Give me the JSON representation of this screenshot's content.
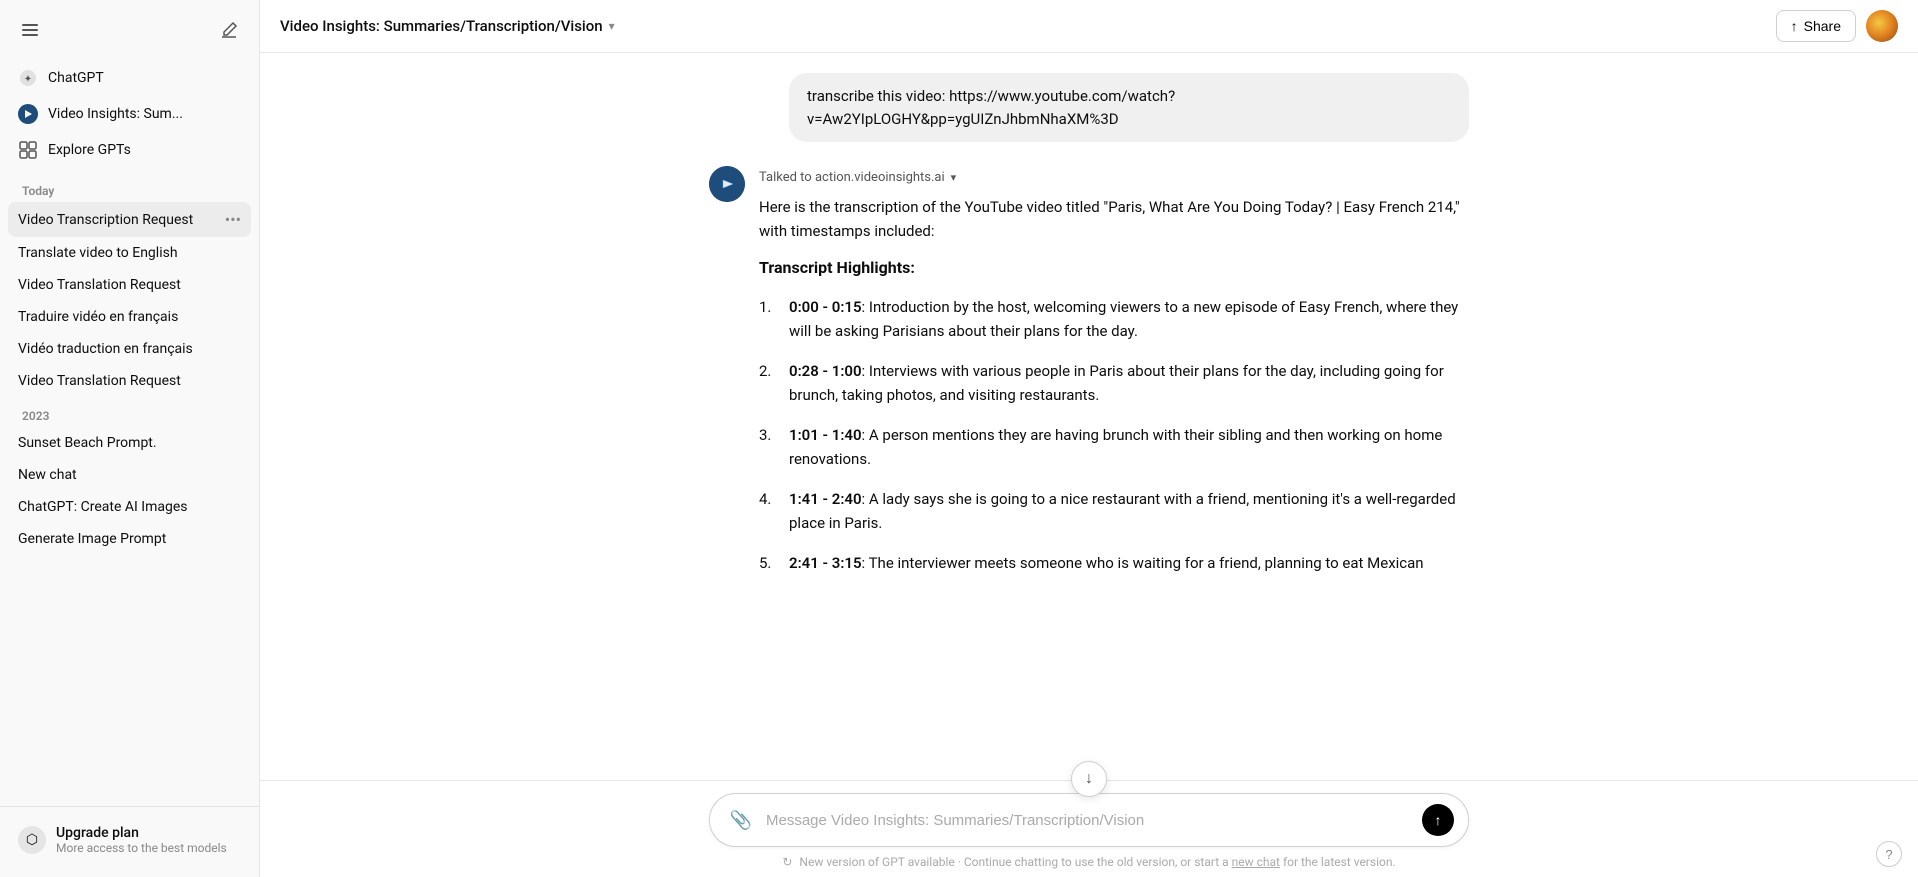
{
  "sidebar": {
    "toggle_label": "Toggle sidebar",
    "new_chat_label": "New chat",
    "nav_items": [
      {
        "id": "chatgpt",
        "label": "ChatGPT",
        "icon": "✦"
      },
      {
        "id": "video-insights",
        "label": "Video Insights: Sum...",
        "icon": "▶"
      },
      {
        "id": "explore",
        "label": "Explore GPTs",
        "icon": "⊞"
      }
    ],
    "sections": [
      {
        "label": "Today",
        "items": [
          {
            "id": "video-transcription",
            "label": "Video Transcription Request",
            "active": true
          },
          {
            "id": "translate-video",
            "label": "Translate video to English"
          },
          {
            "id": "video-translation",
            "label": "Video Translation Request"
          },
          {
            "id": "traduire-video",
            "label": "Traduire vidéo en français"
          },
          {
            "id": "video-traduction",
            "label": "Vidéo traduction en français"
          },
          {
            "id": "video-translation-2",
            "label": "Video Translation Request"
          }
        ]
      },
      {
        "label": "2023",
        "items": [
          {
            "id": "sunset-beach",
            "label": "Sunset Beach Prompt."
          },
          {
            "id": "new-chat",
            "label": "New chat"
          },
          {
            "id": "chatgpt-ai-images",
            "label": "ChatGPT: Create AI Images"
          },
          {
            "id": "generate-image",
            "label": "Generate Image Prompt"
          }
        ]
      }
    ],
    "upgrade": {
      "title": "Upgrade plan",
      "subtitle": "More access to the best models",
      "icon": "⬡"
    }
  },
  "topbar": {
    "title": "Video Insights: Summaries/Transcription/Vision",
    "share_label": "Share",
    "share_icon": "↑"
  },
  "messages": [
    {
      "type": "user",
      "text": "transcribe this video: https://www.youtube.com/watch?v=Aw2YIpLOGHY&pp=ygUIZnJhbmNhaXM%3D"
    },
    {
      "type": "ai",
      "source": "Talked to action.videoinsights.ai",
      "intro": "Here is the transcription of the YouTube video titled \"Paris, What Are You Doing Today? | Easy French 214,\" with timestamps included:",
      "section_heading": "Transcript Highlights:",
      "items": [
        {
          "num": "1.",
          "timestamp": "0:00 - 0:15",
          "text": ": Introduction by the host, welcoming viewers to a new episode of Easy French, where they will be asking Parisians about their plans for the day."
        },
        {
          "num": "2.",
          "timestamp": "0:28 - 1:00",
          "text": ": Interviews with various people in Paris about their plans for the day, including going for brunch, taking photos, and visiting restaurants."
        },
        {
          "num": "3.",
          "timestamp": "1:01 - 1:40",
          "text": ": A person mentions they are having brunch with their sibling and then working on home renovations."
        },
        {
          "num": "4.",
          "timestamp": "1:41 - 2:40",
          "text": ": A lady says she is going to a nice restaurant with a friend, mentioning it's a well-regarded place in Paris."
        },
        {
          "num": "5.",
          "timestamp": "2:41 - 3:15",
          "text": ": The interviewer meets someone who is waiting for a friend, planning to eat Mexican"
        }
      ]
    }
  ],
  "input": {
    "placeholder": "Message Video Insights: Summaries/Transcription/Vision"
  },
  "footer": {
    "notice": "New version of GPT available · Continue chatting to use the old version, or start a ",
    "link_text": "new chat",
    "notice_end": " for the latest version.",
    "refresh_icon": "↻",
    "help_label": "?"
  }
}
